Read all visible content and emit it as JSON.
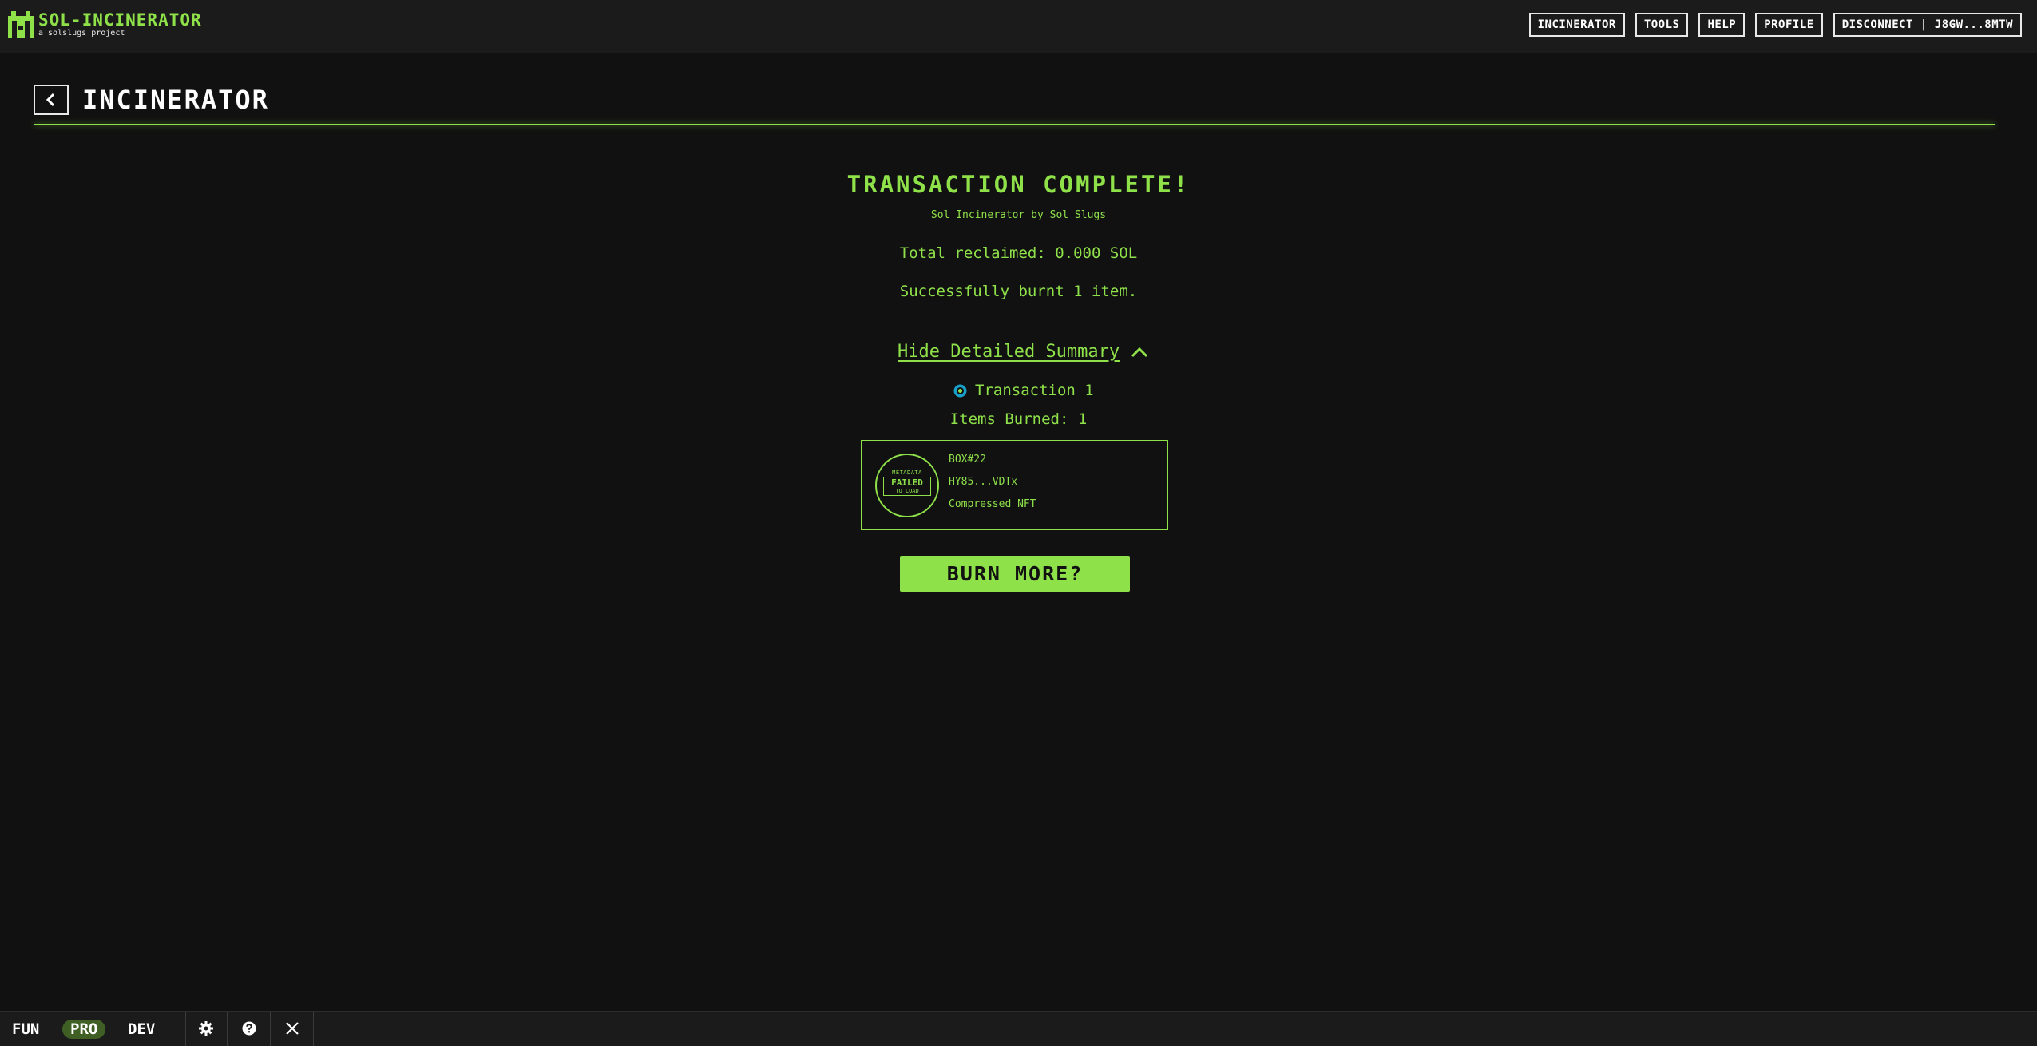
{
  "header": {
    "logo_title": "SOL-INCINERATOR",
    "logo_subtitle": "a solslugs project",
    "nav": [
      {
        "label": "INCINERATOR"
      },
      {
        "label": "TOOLS"
      },
      {
        "label": "HELP"
      },
      {
        "label": "PROFILE"
      },
      {
        "label": "DISCONNECT | J8GW...8MTW"
      }
    ]
  },
  "page": {
    "title": "INCINERATOR"
  },
  "result": {
    "title": "TRANSACTION COMPLETE!",
    "subtitle": "Sol Incinerator by Sol Slugs",
    "total_reclaimed": "Total reclaimed: 0.000 SOL",
    "burnt_message": "Successfully burnt 1 item.",
    "summary_toggle": "Hide Detailed Summary",
    "transaction_link": "Transaction 1",
    "items_burned": "Items Burned: 1",
    "burn_more": "BURN MORE?"
  },
  "nft": {
    "thumb_top": "METADATA",
    "thumb_failed": "FAILED",
    "thumb_bottom": "TO LOAD",
    "name": "BOX#22",
    "address": "HY85...VDTx",
    "type": "Compressed NFT"
  },
  "footer": {
    "modes": [
      "FUN",
      "PRO",
      "DEV"
    ],
    "active_mode": "PRO",
    "icons": [
      "gear-icon",
      "help-icon",
      "x-logo-icon"
    ]
  },
  "colors": {
    "accent": "#8fe14a",
    "background": "#111111",
    "topbar": "#1b1b1b",
    "active_pill": "#3f5f25"
  }
}
